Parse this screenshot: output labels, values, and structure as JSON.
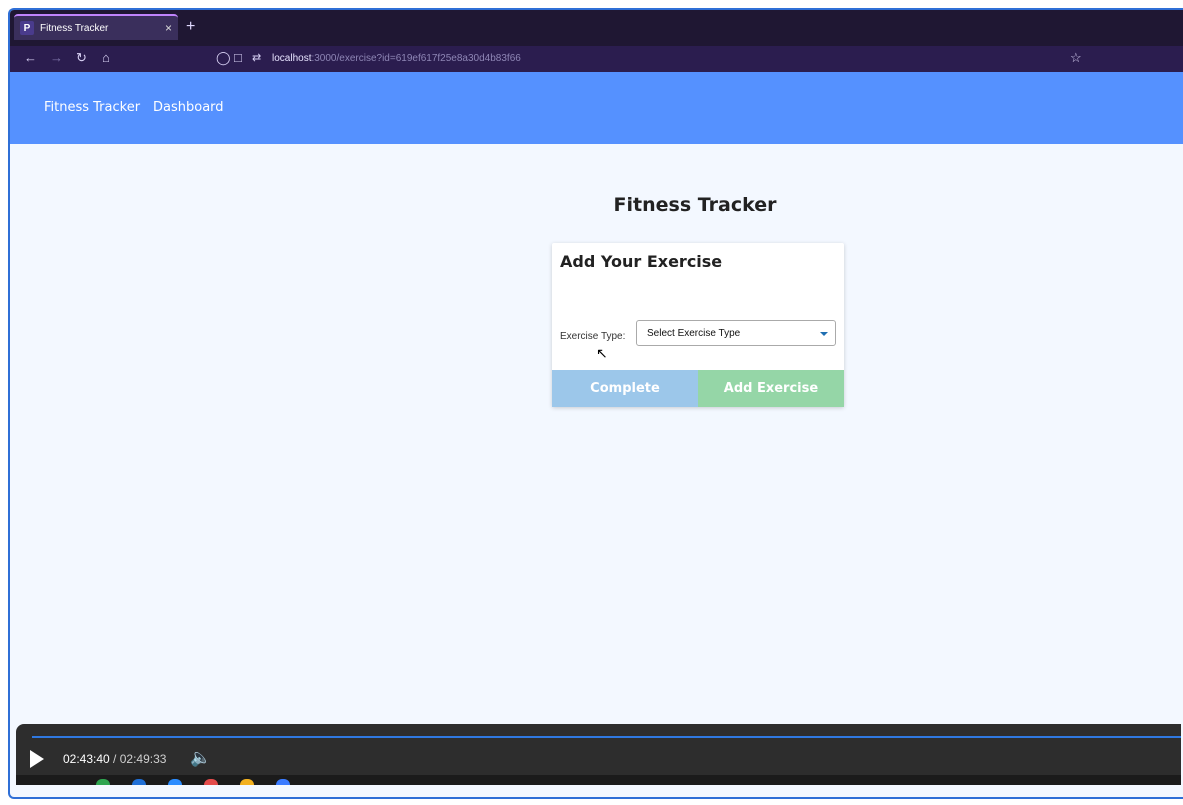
{
  "browser": {
    "tab_title": "Fitness Tracker",
    "tab_favicon": "P",
    "close_glyph": "×",
    "new_tab_glyph": "+",
    "url_host": "localhost",
    "url_rest": ":3000/exercise?id=619ef617f25e8a30d4b83f66"
  },
  "appnav": {
    "brand": "Fitness Tracker",
    "dashboard": "Dashboard"
  },
  "page": {
    "title": "Fitness Tracker"
  },
  "card": {
    "title": "Add Your Exercise",
    "exercise_type_label": "Exercise Type:",
    "exercise_type_value": "Select Exercise Type",
    "complete_button": "Complete",
    "add_button": "Add Exercise"
  },
  "video": {
    "current_time": "02:43:40",
    "separator": " / ",
    "total_time": "02:49:33"
  },
  "colors": {
    "app_header": "#5591ff",
    "complete_button": "#9cc7ea",
    "add_button": "#95d6a7"
  }
}
